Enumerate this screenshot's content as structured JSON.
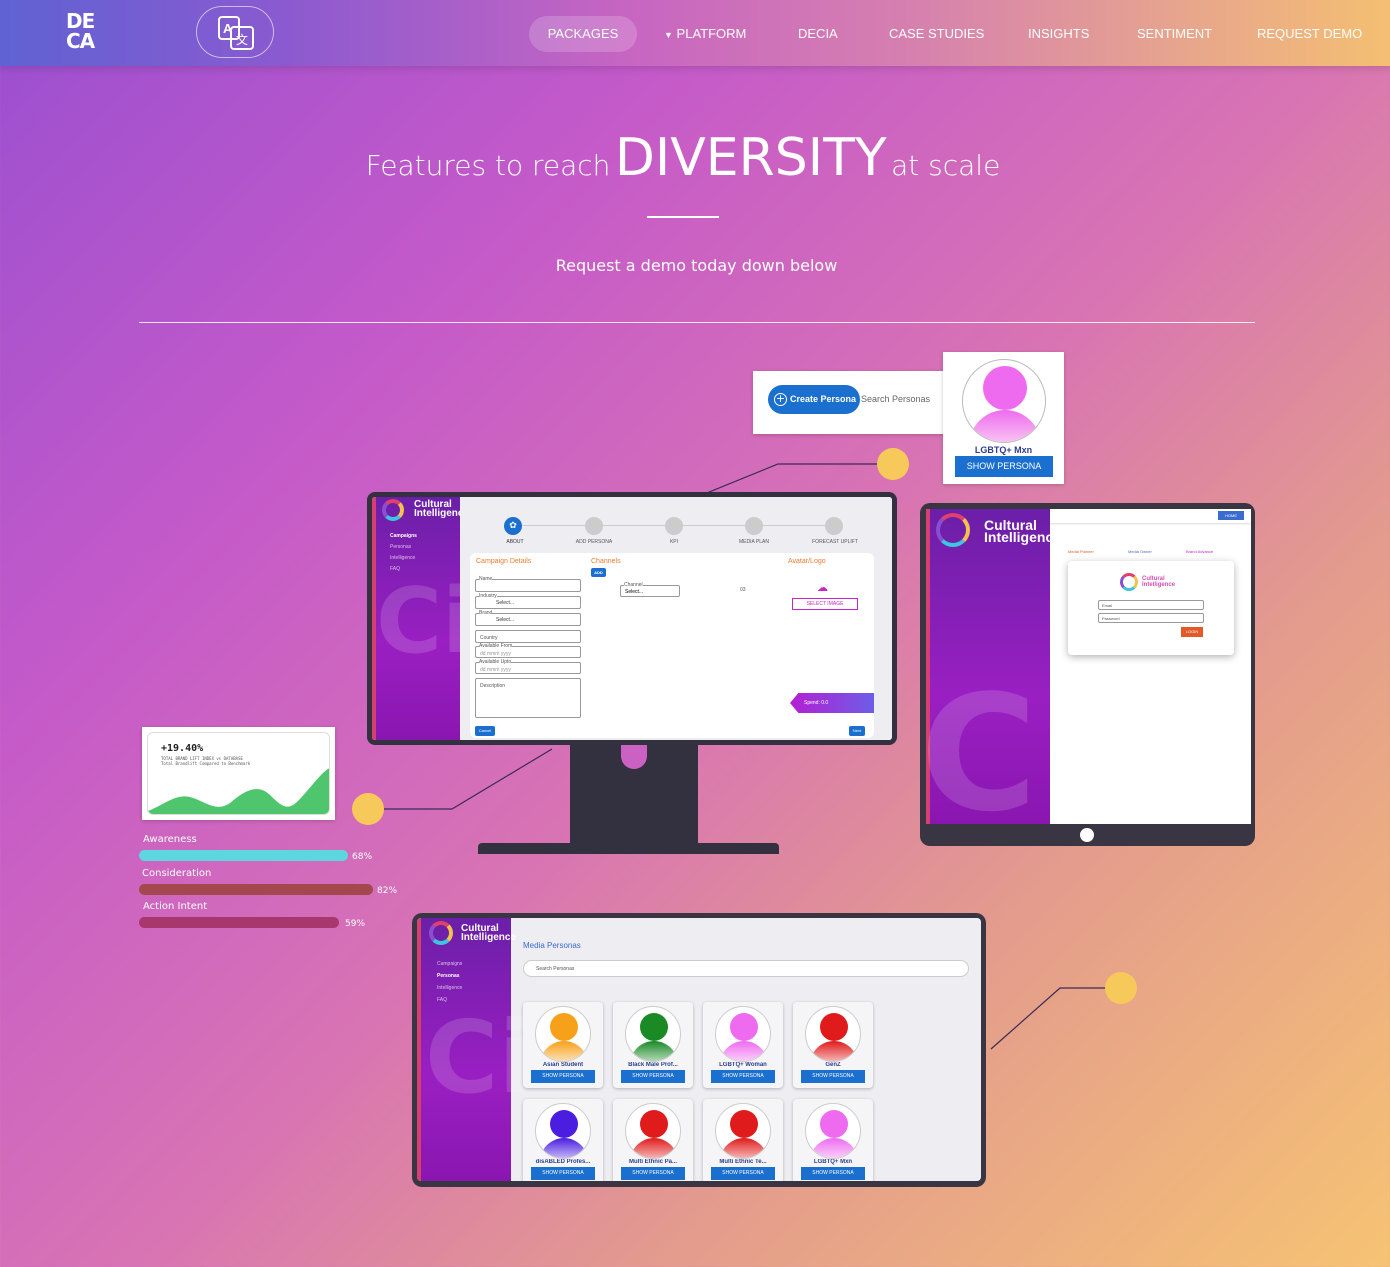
{
  "nav": {
    "items": [
      {
        "label": "PACKAGES"
      },
      {
        "label": "PLATFORM"
      },
      {
        "label": "DECIA"
      },
      {
        "label": "CASE STUDIES"
      },
      {
        "label": "INSIGHTS"
      },
      {
        "label": "SENTIMENT"
      },
      {
        "label": "REQUEST DEMO"
      }
    ],
    "logo_top": "DE",
    "logo_bottom": "CA",
    "chevron_icon": "chevron-down-icon",
    "translate_icon": "translate-icon"
  },
  "hero": {
    "pre": "Features to reach",
    "big": "DIVERSITY",
    "post": "at scale",
    "subtitle": "Request a demo today down below"
  },
  "colors": {
    "accent": "#1a6fcf",
    "callout": "#f6c95a",
    "sidebar": "#7a1bb0"
  },
  "persona_popup": {
    "create_label": "Create Persona",
    "search_placeholder": "Search Personas",
    "persona_name": "LGBTQ+ Mxn",
    "show_label": "SHOW PERSONA"
  },
  "ci": {
    "brand_line1": "Cultural",
    "brand_line2": "Intelligence"
  },
  "monitor": {
    "sidebar": [
      "Campaigns",
      "Personas",
      "Intelligence",
      "FAQ"
    ],
    "steps": [
      "ABOUT",
      "ADD PERSONA",
      "KPI",
      "MEDIA PLAN",
      "FORECAST UPLIFT"
    ],
    "campaign_details": "Campaign Details",
    "channels": "Channels",
    "avatar_logo": "Avatar/Logo",
    "add": "ADD",
    "name": "Name",
    "industry": "Industry",
    "select": "Select...",
    "brand": "Brand",
    "country": "Country",
    "available_from": "Available From",
    "available_upto": "Available Upto",
    "date_placeholder": "dd mmm yyyy",
    "description": "Description",
    "channel": "Channel",
    "count": "03",
    "select_image": "SELECT IMAGE",
    "spend": "Spend: 0.0",
    "cancel": "Cancel",
    "next": "Next"
  },
  "tablet": {
    "home": "HOME",
    "tabs": [
      "Media Planner",
      "Media Owner",
      "Brand Advance"
    ],
    "email": "Email",
    "password": "Password",
    "login": "LOGIN"
  },
  "stat": {
    "value": "+19.40%",
    "line1": "TOTAL BRAND LIFT INDEX vs DATABASE",
    "line2": "Total Brandlift Compared to Benchmark"
  },
  "bars": [
    {
      "label": "Awareness",
      "pct": "68%",
      "value": 0.68,
      "color": "#5ed6e0"
    },
    {
      "label": "Consideration",
      "pct": "82%",
      "value": 0.82,
      "color": "#a5474f"
    },
    {
      "label": "Action Intent",
      "pct": "59%",
      "value": 0.59,
      "color": "#a8376d"
    }
  ],
  "laptop": {
    "title": "Media Personas",
    "search": "Search Personas",
    "sidebar": [
      "Campaigns",
      "Personas",
      "Intelligence",
      "FAQ"
    ],
    "show": "SHOW PERSONA",
    "personas": [
      {
        "name": "Asian Student",
        "color": "#f7a11a"
      },
      {
        "name": "Black Male Prof...",
        "color": "#1a8a25"
      },
      {
        "name": "LGBTQ+ Woman",
        "color": "#ee6bef"
      },
      {
        "name": "GenZ",
        "color": "#e01b1b"
      },
      {
        "name": "disABLED Profes...",
        "color": "#4a1de0"
      },
      {
        "name": "Multi Ethnic Pa...",
        "color": "#e01b1b"
      },
      {
        "name": "Multi Ethnic Te...",
        "color": "#e01b1b"
      },
      {
        "name": "LGBTQ+ Mxn",
        "color": "#ee6bef"
      }
    ]
  }
}
